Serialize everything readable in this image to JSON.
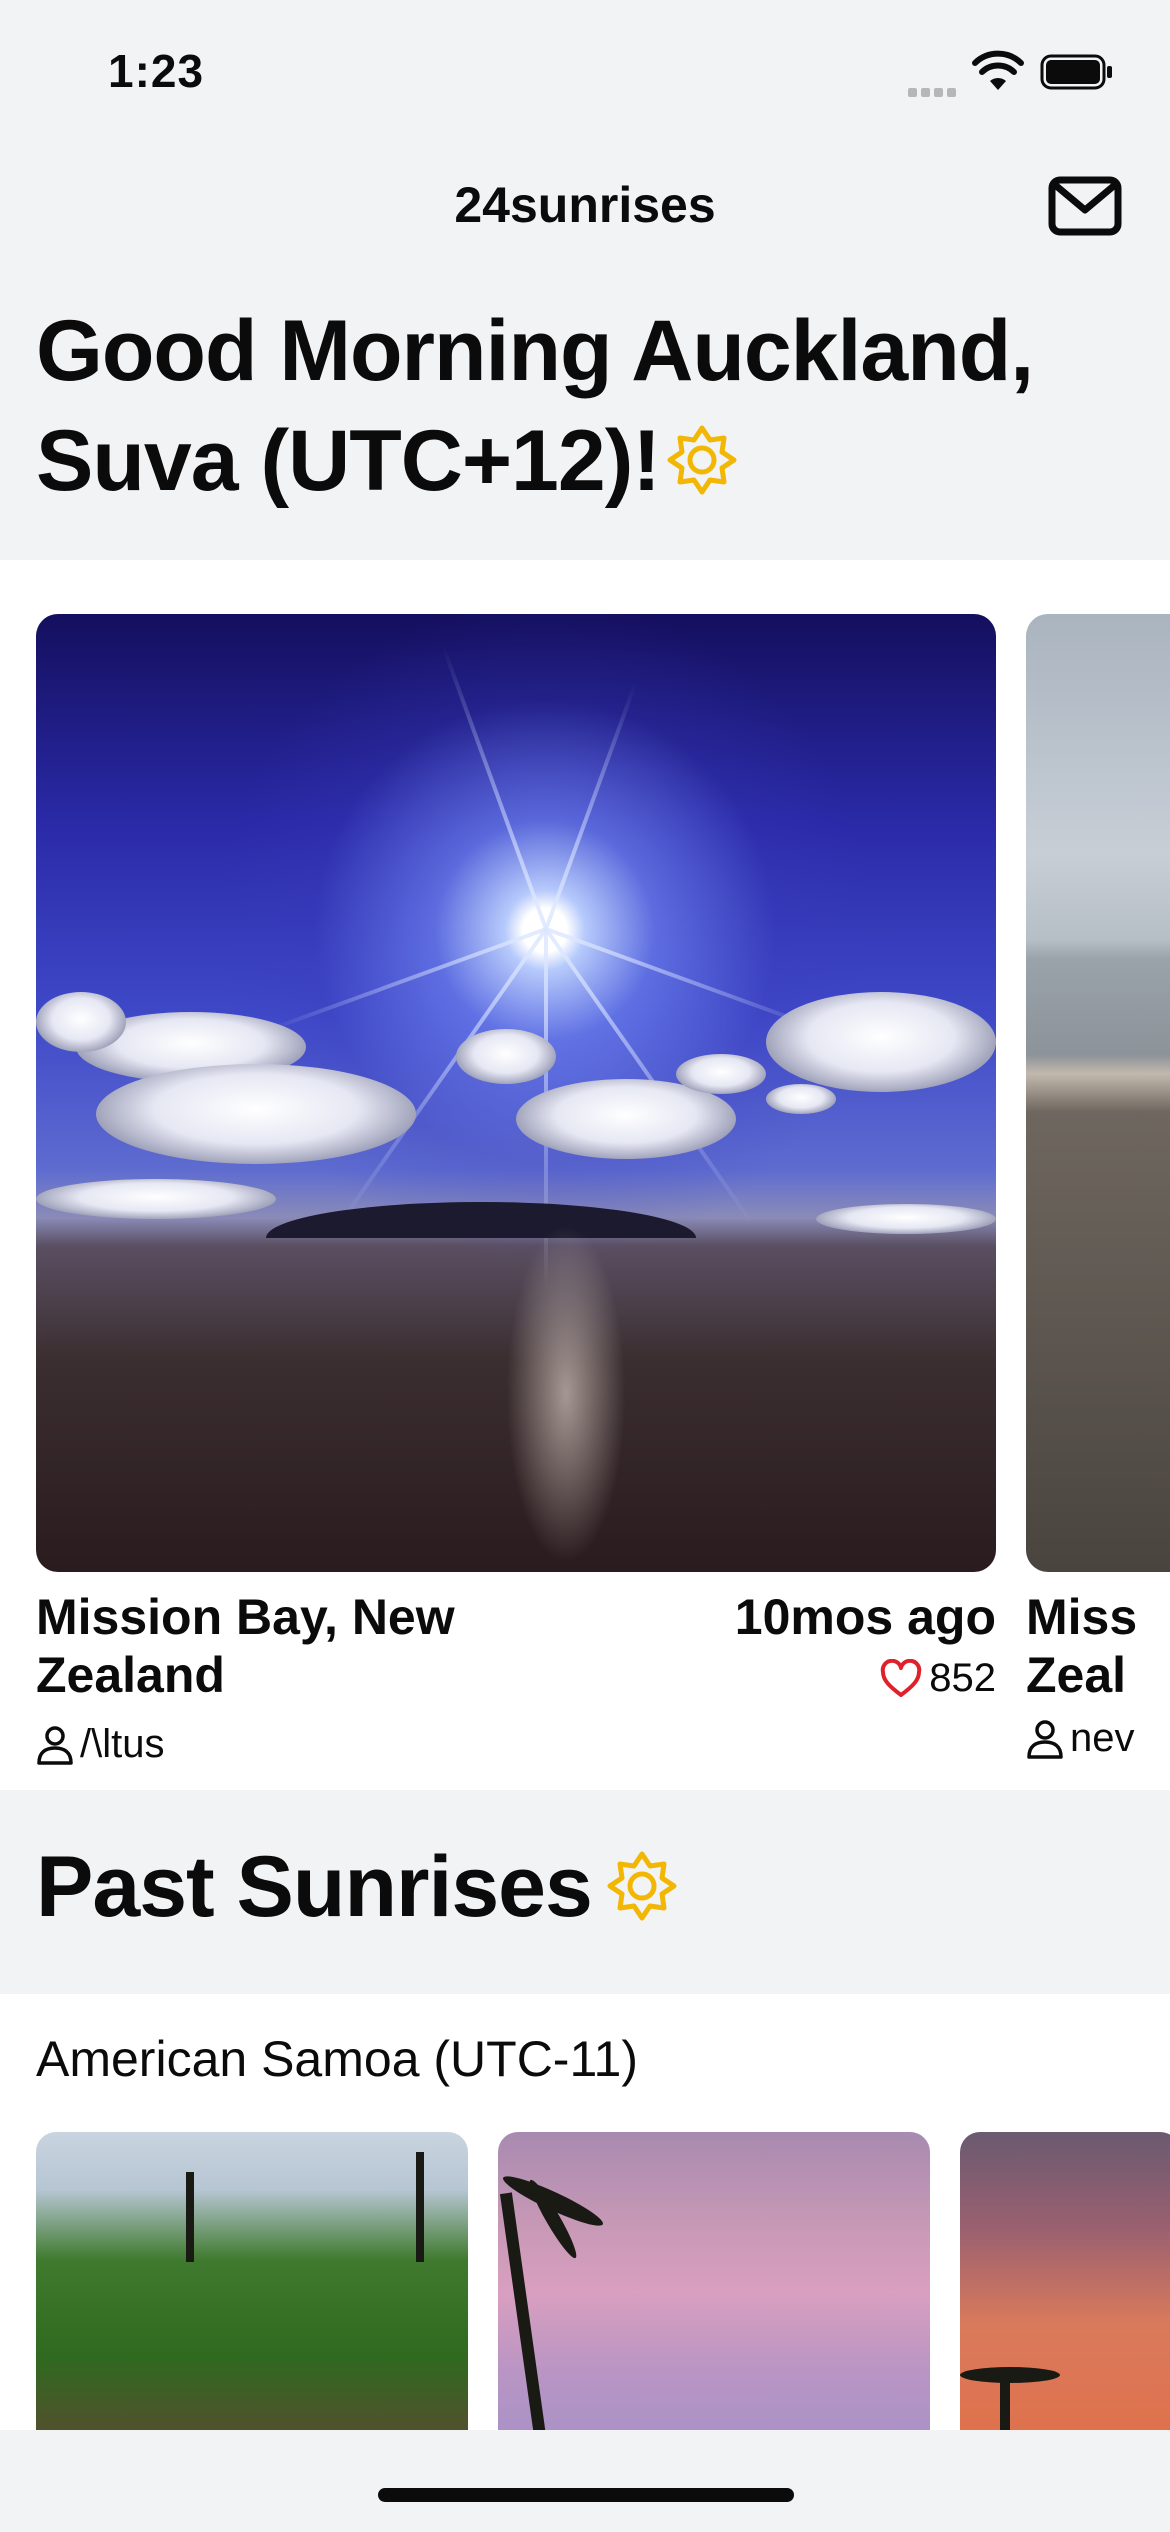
{
  "status": {
    "time": "1:23"
  },
  "nav": {
    "title": "24sunrises"
  },
  "greeting": {
    "text": "Good Morning Auckland, Suva (UTC+12)!"
  },
  "today": {
    "main_card": {
      "location": "Mission Bay, New Zealand",
      "time_ago": "10mos ago",
      "likes": "852",
      "user": "/\\ltus"
    },
    "peek_card": {
      "location_line1": "Miss",
      "location_line2": "Zeal",
      "user": "nev"
    }
  },
  "past": {
    "title": "Past Sunrises",
    "timezone": "American Samoa (UTC-11)"
  },
  "colors": {
    "accent_sun": "#f2b705",
    "heart": "#e0202b",
    "background": "#f2f3f5"
  }
}
